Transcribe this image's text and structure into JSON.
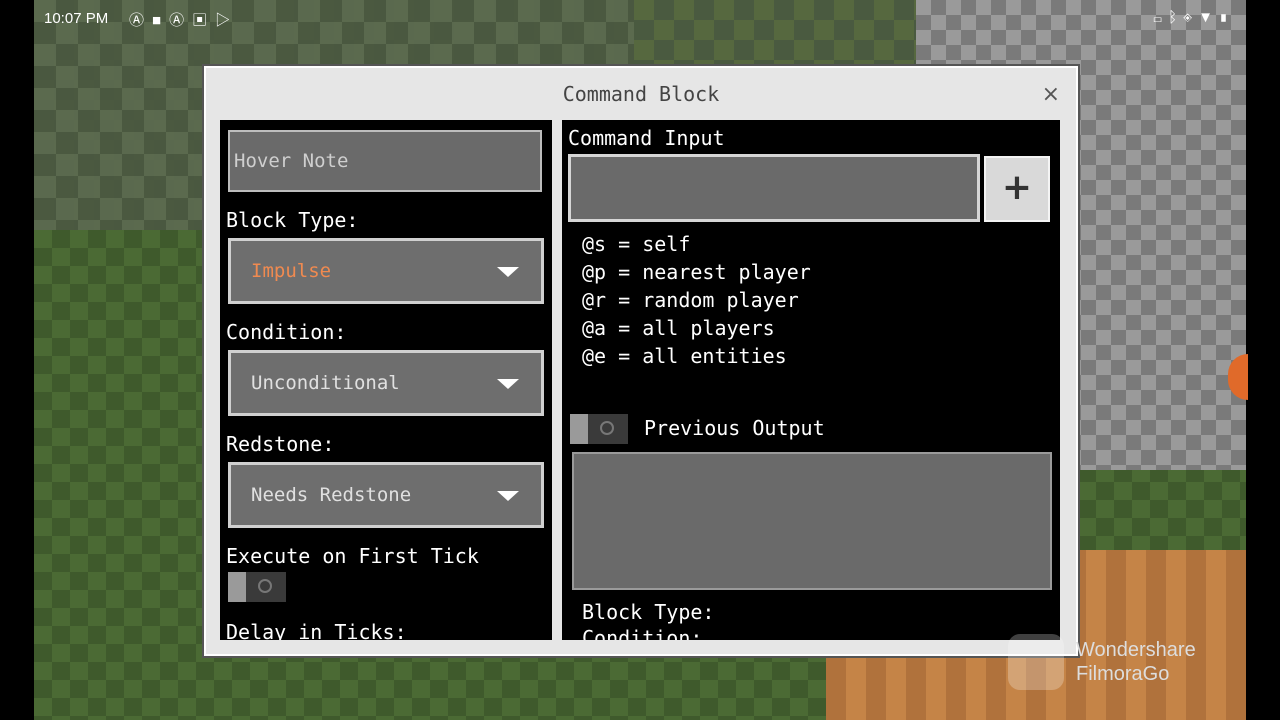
{
  "status_bar": {
    "time": "10:07 PM",
    "left_icons": [
      "notification-a-icon",
      "video-icon",
      "notification-a-icon",
      "image-icon",
      "play-store-icon"
    ],
    "right_icons": [
      "cast-icon",
      "bluetooth-icon",
      "vibrate-icon",
      "wifi-icon",
      "battery-icon"
    ]
  },
  "dialog": {
    "title": "Command Block",
    "close_label": "×"
  },
  "left_panel": {
    "hover_note_placeholder": "Hover Note",
    "block_type_label": "Block Type:",
    "block_type_value": "Impulse",
    "condition_label": "Condition:",
    "condition_value": "Unconditional",
    "redstone_label": "Redstone:",
    "redstone_value": "Needs Redstone",
    "execute_first_tick_label": "Execute on First Tick",
    "delay_label": "Delay in Ticks:"
  },
  "right_panel": {
    "command_input_label": "Command Input",
    "plus_label": "+",
    "selectors": [
      "@s = self",
      "@p = nearest player",
      "@r = random player",
      "@a = all players",
      "@e = all entities"
    ],
    "previous_output_label": "Previous Output",
    "bottom_block_type_label": "Block Type:",
    "bottom_condition_label": "Condition:"
  },
  "watermark": {
    "line1": "Wondershare",
    "line2": "FilmoraGo"
  },
  "colors": {
    "impulse_text": "#f08a50",
    "panel_bg": "#000000",
    "dialog_bg": "#e6e6e6"
  }
}
